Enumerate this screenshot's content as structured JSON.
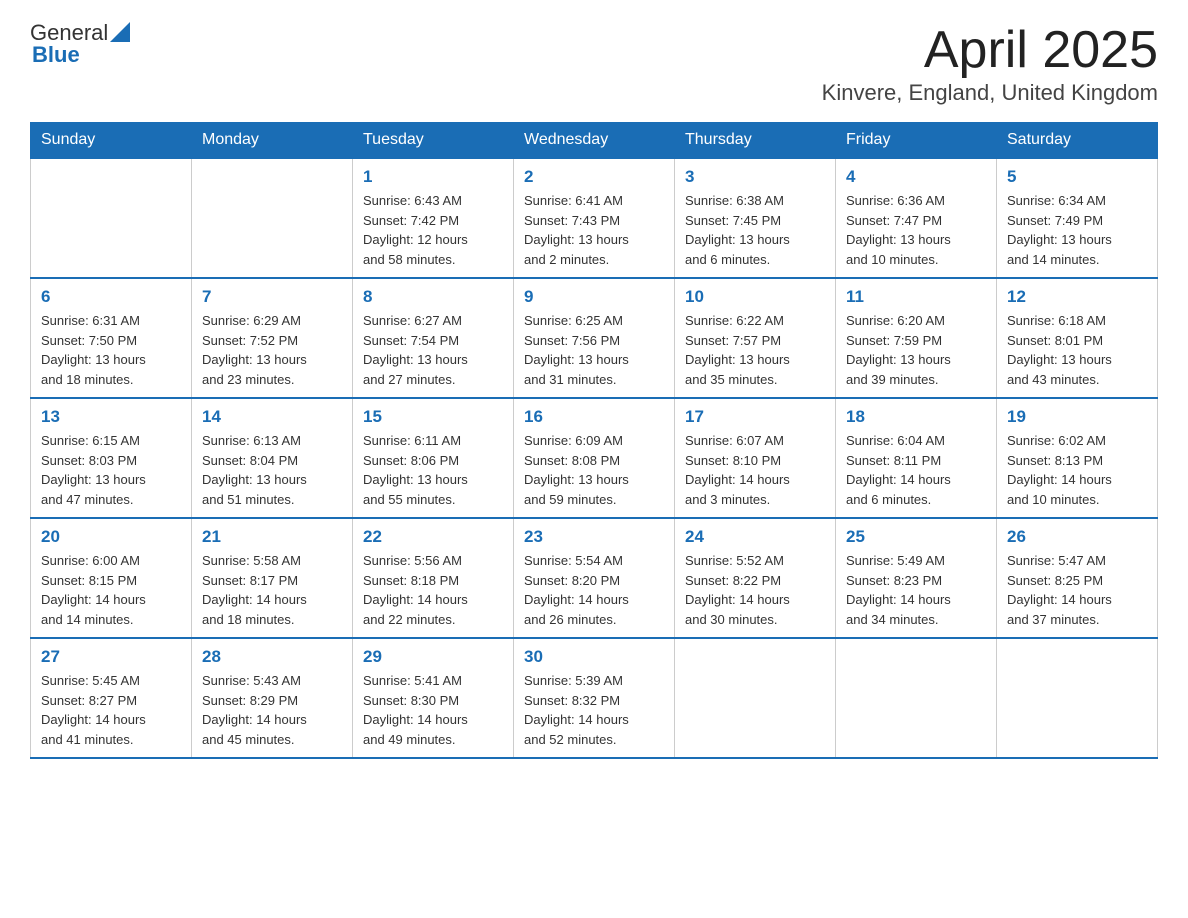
{
  "header": {
    "logo_general": "General",
    "logo_blue": "Blue",
    "title": "April 2025",
    "subtitle": "Kinvere, England, United Kingdom"
  },
  "weekdays": [
    "Sunday",
    "Monday",
    "Tuesday",
    "Wednesday",
    "Thursday",
    "Friday",
    "Saturday"
  ],
  "weeks": [
    [
      {
        "day": "",
        "info": ""
      },
      {
        "day": "",
        "info": ""
      },
      {
        "day": "1",
        "info": "Sunrise: 6:43 AM\nSunset: 7:42 PM\nDaylight: 12 hours\nand 58 minutes."
      },
      {
        "day": "2",
        "info": "Sunrise: 6:41 AM\nSunset: 7:43 PM\nDaylight: 13 hours\nand 2 minutes."
      },
      {
        "day": "3",
        "info": "Sunrise: 6:38 AM\nSunset: 7:45 PM\nDaylight: 13 hours\nand 6 minutes."
      },
      {
        "day": "4",
        "info": "Sunrise: 6:36 AM\nSunset: 7:47 PM\nDaylight: 13 hours\nand 10 minutes."
      },
      {
        "day": "5",
        "info": "Sunrise: 6:34 AM\nSunset: 7:49 PM\nDaylight: 13 hours\nand 14 minutes."
      }
    ],
    [
      {
        "day": "6",
        "info": "Sunrise: 6:31 AM\nSunset: 7:50 PM\nDaylight: 13 hours\nand 18 minutes."
      },
      {
        "day": "7",
        "info": "Sunrise: 6:29 AM\nSunset: 7:52 PM\nDaylight: 13 hours\nand 23 minutes."
      },
      {
        "day": "8",
        "info": "Sunrise: 6:27 AM\nSunset: 7:54 PM\nDaylight: 13 hours\nand 27 minutes."
      },
      {
        "day": "9",
        "info": "Sunrise: 6:25 AM\nSunset: 7:56 PM\nDaylight: 13 hours\nand 31 minutes."
      },
      {
        "day": "10",
        "info": "Sunrise: 6:22 AM\nSunset: 7:57 PM\nDaylight: 13 hours\nand 35 minutes."
      },
      {
        "day": "11",
        "info": "Sunrise: 6:20 AM\nSunset: 7:59 PM\nDaylight: 13 hours\nand 39 minutes."
      },
      {
        "day": "12",
        "info": "Sunrise: 6:18 AM\nSunset: 8:01 PM\nDaylight: 13 hours\nand 43 minutes."
      }
    ],
    [
      {
        "day": "13",
        "info": "Sunrise: 6:15 AM\nSunset: 8:03 PM\nDaylight: 13 hours\nand 47 minutes."
      },
      {
        "day": "14",
        "info": "Sunrise: 6:13 AM\nSunset: 8:04 PM\nDaylight: 13 hours\nand 51 minutes."
      },
      {
        "day": "15",
        "info": "Sunrise: 6:11 AM\nSunset: 8:06 PM\nDaylight: 13 hours\nand 55 minutes."
      },
      {
        "day": "16",
        "info": "Sunrise: 6:09 AM\nSunset: 8:08 PM\nDaylight: 13 hours\nand 59 minutes."
      },
      {
        "day": "17",
        "info": "Sunrise: 6:07 AM\nSunset: 8:10 PM\nDaylight: 14 hours\nand 3 minutes."
      },
      {
        "day": "18",
        "info": "Sunrise: 6:04 AM\nSunset: 8:11 PM\nDaylight: 14 hours\nand 6 minutes."
      },
      {
        "day": "19",
        "info": "Sunrise: 6:02 AM\nSunset: 8:13 PM\nDaylight: 14 hours\nand 10 minutes."
      }
    ],
    [
      {
        "day": "20",
        "info": "Sunrise: 6:00 AM\nSunset: 8:15 PM\nDaylight: 14 hours\nand 14 minutes."
      },
      {
        "day": "21",
        "info": "Sunrise: 5:58 AM\nSunset: 8:17 PM\nDaylight: 14 hours\nand 18 minutes."
      },
      {
        "day": "22",
        "info": "Sunrise: 5:56 AM\nSunset: 8:18 PM\nDaylight: 14 hours\nand 22 minutes."
      },
      {
        "day": "23",
        "info": "Sunrise: 5:54 AM\nSunset: 8:20 PM\nDaylight: 14 hours\nand 26 minutes."
      },
      {
        "day": "24",
        "info": "Sunrise: 5:52 AM\nSunset: 8:22 PM\nDaylight: 14 hours\nand 30 minutes."
      },
      {
        "day": "25",
        "info": "Sunrise: 5:49 AM\nSunset: 8:23 PM\nDaylight: 14 hours\nand 34 minutes."
      },
      {
        "day": "26",
        "info": "Sunrise: 5:47 AM\nSunset: 8:25 PM\nDaylight: 14 hours\nand 37 minutes."
      }
    ],
    [
      {
        "day": "27",
        "info": "Sunrise: 5:45 AM\nSunset: 8:27 PM\nDaylight: 14 hours\nand 41 minutes."
      },
      {
        "day": "28",
        "info": "Sunrise: 5:43 AM\nSunset: 8:29 PM\nDaylight: 14 hours\nand 45 minutes."
      },
      {
        "day": "29",
        "info": "Sunrise: 5:41 AM\nSunset: 8:30 PM\nDaylight: 14 hours\nand 49 minutes."
      },
      {
        "day": "30",
        "info": "Sunrise: 5:39 AM\nSunset: 8:32 PM\nDaylight: 14 hours\nand 52 minutes."
      },
      {
        "day": "",
        "info": ""
      },
      {
        "day": "",
        "info": ""
      },
      {
        "day": "",
        "info": ""
      }
    ]
  ]
}
